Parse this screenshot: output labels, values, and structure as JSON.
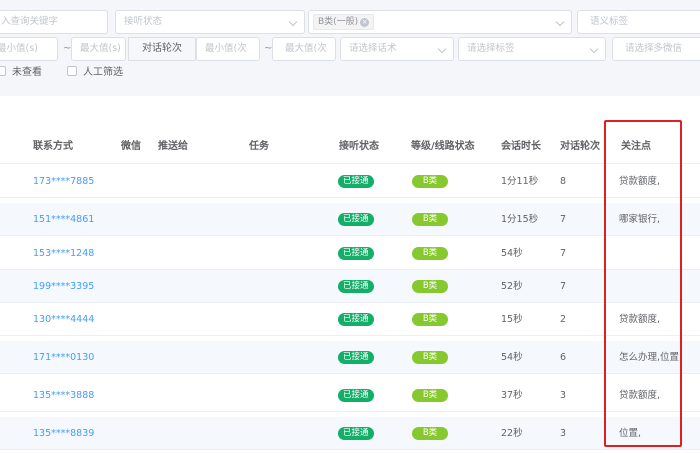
{
  "filters": {
    "keyword_placeholder": "入查询关键字",
    "listen_status_placeholder": "接听状态",
    "grade_selected_tag": "B类(一般)",
    "grade_tag_close": "×",
    "voice_tag_placeholder": "语义标签",
    "min_value_placeholder": "最小值(s)",
    "max_value_placeholder": "最大值(s)",
    "range_separator": "~",
    "dialog_rounds_label": "对话轮次",
    "rounds_min_placeholder": "最小值(次",
    "rounds_max_placeholder": "最大值(次",
    "script_placeholder": "请选择话术",
    "tag_placeholder": "请选择标签",
    "wechat_placeholder": "请选择多微信",
    "unviewed_label": "未查看",
    "manual_filter_label": "人工筛选"
  },
  "table": {
    "headers": {
      "contact": "联系方式",
      "wechat": "微信",
      "push_to": "推送给",
      "task": "任务",
      "listen_status": "接听状态",
      "grade": "等级/线路状态",
      "duration": "会话时长",
      "rounds": "对话轮次",
      "focus": "关注点"
    },
    "rows": [
      {
        "phone": "173****7885",
        "status": "已接通",
        "grade": "B类",
        "duration": "1分11秒",
        "rounds": "8",
        "focus": "贷款额度,"
      },
      {
        "phone": "151****4861",
        "status": "已接通",
        "grade": "B类",
        "duration": "1分15秒",
        "rounds": "7",
        "focus": "哪家银行,"
      },
      {
        "phone": "153****1248",
        "status": "已接通",
        "grade": "B类",
        "duration": "54秒",
        "rounds": "7",
        "focus": ""
      },
      {
        "phone": "199****3395",
        "status": "已接通",
        "grade": "B类",
        "duration": "52秒",
        "rounds": "7",
        "focus": ""
      },
      {
        "phone": "130****4444",
        "status": "已接通",
        "grade": "B类",
        "duration": "15秒",
        "rounds": "2",
        "focus": "贷款额度,"
      },
      {
        "phone": "171****0130",
        "status": "已接通",
        "grade": "B类",
        "duration": "54秒",
        "rounds": "6",
        "focus": "怎么办理,位置,"
      },
      {
        "phone": "135****3888",
        "status": "已接通",
        "grade": "B类",
        "duration": "37秒",
        "rounds": "3",
        "focus": "贷款额度,"
      },
      {
        "phone": "135****8839",
        "status": "已接通",
        "grade": "B类",
        "duration": "22秒",
        "rounds": "3",
        "focus": "位置,"
      }
    ]
  },
  "colors": {
    "connected_badge": "#13ae67",
    "grade_badge": "#86c92e",
    "phone_link": "#409eff",
    "highlight_border": "#e02020"
  }
}
